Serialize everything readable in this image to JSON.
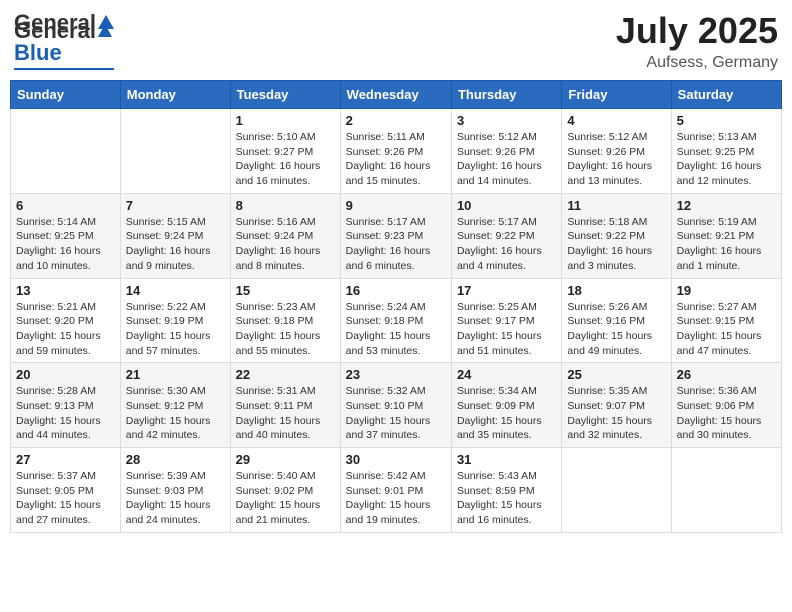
{
  "header": {
    "logo_general": "General",
    "logo_blue": "Blue",
    "month_year": "July 2025",
    "location": "Aufsess, Germany"
  },
  "days_of_week": [
    "Sunday",
    "Monday",
    "Tuesday",
    "Wednesday",
    "Thursday",
    "Friday",
    "Saturday"
  ],
  "weeks": [
    [
      {
        "num": "",
        "info": ""
      },
      {
        "num": "",
        "info": ""
      },
      {
        "num": "1",
        "info": "Sunrise: 5:10 AM\nSunset: 9:27 PM\nDaylight: 16 hours and 16 minutes."
      },
      {
        "num": "2",
        "info": "Sunrise: 5:11 AM\nSunset: 9:26 PM\nDaylight: 16 hours and 15 minutes."
      },
      {
        "num": "3",
        "info": "Sunrise: 5:12 AM\nSunset: 9:26 PM\nDaylight: 16 hours and 14 minutes."
      },
      {
        "num": "4",
        "info": "Sunrise: 5:12 AM\nSunset: 9:26 PM\nDaylight: 16 hours and 13 minutes."
      },
      {
        "num": "5",
        "info": "Sunrise: 5:13 AM\nSunset: 9:25 PM\nDaylight: 16 hours and 12 minutes."
      }
    ],
    [
      {
        "num": "6",
        "info": "Sunrise: 5:14 AM\nSunset: 9:25 PM\nDaylight: 16 hours and 10 minutes."
      },
      {
        "num": "7",
        "info": "Sunrise: 5:15 AM\nSunset: 9:24 PM\nDaylight: 16 hours and 9 minutes."
      },
      {
        "num": "8",
        "info": "Sunrise: 5:16 AM\nSunset: 9:24 PM\nDaylight: 16 hours and 8 minutes."
      },
      {
        "num": "9",
        "info": "Sunrise: 5:17 AM\nSunset: 9:23 PM\nDaylight: 16 hours and 6 minutes."
      },
      {
        "num": "10",
        "info": "Sunrise: 5:17 AM\nSunset: 9:22 PM\nDaylight: 16 hours and 4 minutes."
      },
      {
        "num": "11",
        "info": "Sunrise: 5:18 AM\nSunset: 9:22 PM\nDaylight: 16 hours and 3 minutes."
      },
      {
        "num": "12",
        "info": "Sunrise: 5:19 AM\nSunset: 9:21 PM\nDaylight: 16 hours and 1 minute."
      }
    ],
    [
      {
        "num": "13",
        "info": "Sunrise: 5:21 AM\nSunset: 9:20 PM\nDaylight: 15 hours and 59 minutes."
      },
      {
        "num": "14",
        "info": "Sunrise: 5:22 AM\nSunset: 9:19 PM\nDaylight: 15 hours and 57 minutes."
      },
      {
        "num": "15",
        "info": "Sunrise: 5:23 AM\nSunset: 9:18 PM\nDaylight: 15 hours and 55 minutes."
      },
      {
        "num": "16",
        "info": "Sunrise: 5:24 AM\nSunset: 9:18 PM\nDaylight: 15 hours and 53 minutes."
      },
      {
        "num": "17",
        "info": "Sunrise: 5:25 AM\nSunset: 9:17 PM\nDaylight: 15 hours and 51 minutes."
      },
      {
        "num": "18",
        "info": "Sunrise: 5:26 AM\nSunset: 9:16 PM\nDaylight: 15 hours and 49 minutes."
      },
      {
        "num": "19",
        "info": "Sunrise: 5:27 AM\nSunset: 9:15 PM\nDaylight: 15 hours and 47 minutes."
      }
    ],
    [
      {
        "num": "20",
        "info": "Sunrise: 5:28 AM\nSunset: 9:13 PM\nDaylight: 15 hours and 44 minutes."
      },
      {
        "num": "21",
        "info": "Sunrise: 5:30 AM\nSunset: 9:12 PM\nDaylight: 15 hours and 42 minutes."
      },
      {
        "num": "22",
        "info": "Sunrise: 5:31 AM\nSunset: 9:11 PM\nDaylight: 15 hours and 40 minutes."
      },
      {
        "num": "23",
        "info": "Sunrise: 5:32 AM\nSunset: 9:10 PM\nDaylight: 15 hours and 37 minutes."
      },
      {
        "num": "24",
        "info": "Sunrise: 5:34 AM\nSunset: 9:09 PM\nDaylight: 15 hours and 35 minutes."
      },
      {
        "num": "25",
        "info": "Sunrise: 5:35 AM\nSunset: 9:07 PM\nDaylight: 15 hours and 32 minutes."
      },
      {
        "num": "26",
        "info": "Sunrise: 5:36 AM\nSunset: 9:06 PM\nDaylight: 15 hours and 30 minutes."
      }
    ],
    [
      {
        "num": "27",
        "info": "Sunrise: 5:37 AM\nSunset: 9:05 PM\nDaylight: 15 hours and 27 minutes."
      },
      {
        "num": "28",
        "info": "Sunrise: 5:39 AM\nSunset: 9:03 PM\nDaylight: 15 hours and 24 minutes."
      },
      {
        "num": "29",
        "info": "Sunrise: 5:40 AM\nSunset: 9:02 PM\nDaylight: 15 hours and 21 minutes."
      },
      {
        "num": "30",
        "info": "Sunrise: 5:42 AM\nSunset: 9:01 PM\nDaylight: 15 hours and 19 minutes."
      },
      {
        "num": "31",
        "info": "Sunrise: 5:43 AM\nSunset: 8:59 PM\nDaylight: 15 hours and 16 minutes."
      },
      {
        "num": "",
        "info": ""
      },
      {
        "num": "",
        "info": ""
      }
    ]
  ]
}
